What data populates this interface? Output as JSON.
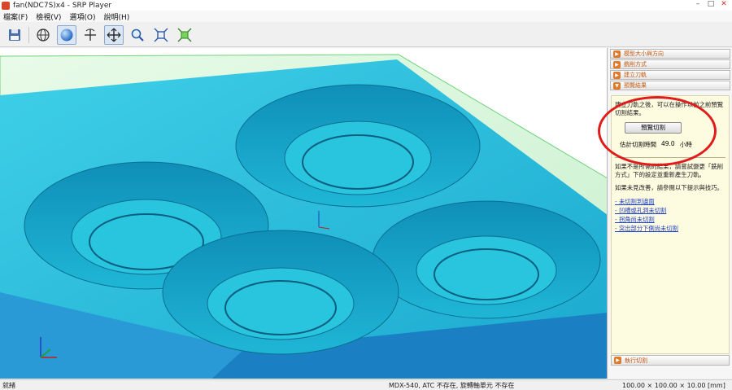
{
  "window": {
    "title": "fan(NDC7S)x4 - SRP Player",
    "minimize": "–",
    "maximize": "□",
    "close": "✕"
  },
  "menu": [
    "檔案(F)",
    "檢視(V)",
    "選項(O)",
    "說明(H)"
  ],
  "toolbar": {
    "icons": [
      "save-icon",
      "wireframe-globe-icon",
      "shaded-sphere-icon",
      "rotate-icon",
      "pan-icon",
      "zoom-icon",
      "fit-all-icon",
      "fit-selection-icon"
    ]
  },
  "panel": {
    "steps": [
      "模型大小與方向",
      "銑削方式",
      "建立刀軌",
      "預覽結果"
    ],
    "intro": "建立刀軌之後，可以在操作以前之前預覽切割結果。",
    "preview_button": "預覽切割",
    "estimate_label": "估計切割時間",
    "estimate_value": "49.0",
    "estimate_unit": "小時",
    "help1": "如果不是所需的結果，請嘗試變更「銑削方式」下的設定並重新產生刀軌。",
    "help2": "如果未見改善，請參閱以下提示與技巧。",
    "links": [
      "- 未切割到邊面",
      "- 凹槽或孔洞未切割",
      "- 拐角尚未切割",
      "- 突出部分下側尚未切割"
    ],
    "run_button": "執行切割"
  },
  "status": {
    "left": "就緒",
    "middle": "MDX-540, ATC 不存在, 旋轉軸單元 不存在",
    "right": "100.00 × 100.00 × 10.00 [mm]"
  },
  "colors": {
    "accent_orange": "#e07a2b",
    "model_cyan": "#22bcd6",
    "callout_red": "#e01b1b",
    "link_blue": "#1f3fc4"
  }
}
